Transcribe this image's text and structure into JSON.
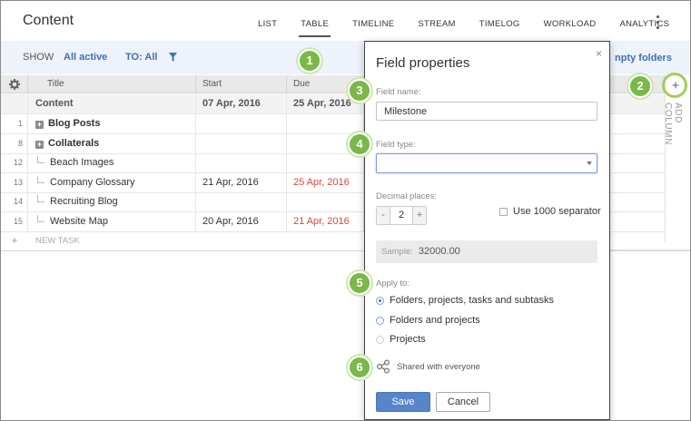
{
  "app": {
    "title": "Content"
  },
  "tabs": [
    "LIST",
    "TABLE",
    "TIMELINE",
    "STREAM",
    "TIMELOG",
    "WORKLOAD",
    "ANALYTICS"
  ],
  "active_tab": "TABLE",
  "filter": {
    "show_label": "SHOW",
    "show_value": "All active",
    "to_value": "TO: All",
    "folders_link": "npty folders"
  },
  "table": {
    "headers": {
      "title": "Title",
      "start": "Start",
      "due": "Due"
    },
    "summary": {
      "title": "Content",
      "start": "07 Apr, 2016",
      "due": "25 Apr, 2016"
    },
    "rows": [
      {
        "num": "1",
        "title": "Blog Posts",
        "start": "",
        "due": "",
        "type": "folder"
      },
      {
        "num": "8",
        "title": "Collaterals",
        "start": "",
        "due": "",
        "type": "folder"
      },
      {
        "num": "12",
        "title": "Beach Images",
        "start": "",
        "due": "",
        "type": "task"
      },
      {
        "num": "13",
        "title": "Company Glossary",
        "start": "21 Apr, 2016",
        "due": "25 Apr, 2016",
        "type": "task"
      },
      {
        "num": "14",
        "title": "Recruiting Blog",
        "start": "",
        "due": "",
        "type": "task"
      },
      {
        "num": "15",
        "title": "Website Map",
        "start": "20 Apr, 2016",
        "due": "21 Apr, 2016",
        "type": "task"
      }
    ],
    "new_task": "NEW TASK"
  },
  "add_column": {
    "plus": "+",
    "label": "ADD COLUMN"
  },
  "dialog": {
    "title": "Field properties",
    "close": "×",
    "field_name_label": "Field name:",
    "field_name_value": "Milestone",
    "field_type_label": "Field type:",
    "field_type_value": "",
    "decimal_label": "Decimal places:",
    "decimal_minus": "-",
    "decimal_value": "2",
    "decimal_plus": "+",
    "separator_label": "Use 1000 separator",
    "sample_label": "Sample:",
    "sample_value": "32000.00",
    "apply_label": "Apply to:",
    "apply_options": [
      "Folders, projects, tasks and subtasks",
      "Folders and projects",
      "Projects"
    ],
    "apply_selected": 0,
    "shared_label": "Shared with everyone",
    "save": "Save",
    "cancel": "Cancel"
  },
  "callouts": [
    "1",
    "2",
    "3",
    "4",
    "5",
    "6"
  ],
  "colors": {
    "accent": "#3e6fb5",
    "late": "#d24a3b",
    "callout": "#79b849",
    "filterbar": "#eef3fb"
  }
}
